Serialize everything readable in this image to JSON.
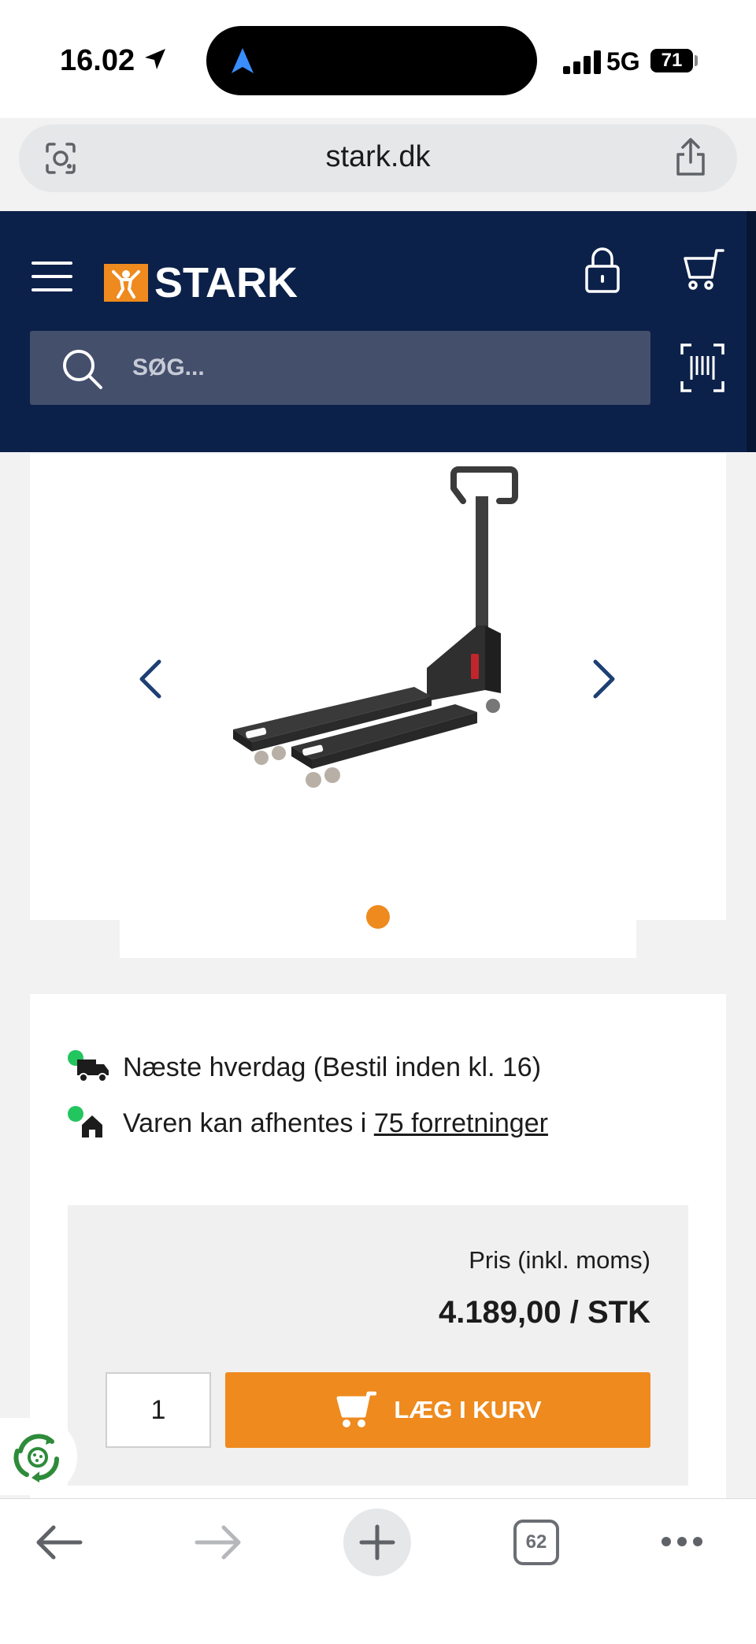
{
  "status_bar": {
    "time": "16.02",
    "network": "5G",
    "battery": "71"
  },
  "browser": {
    "url": "stark.dk",
    "tab_count": "62"
  },
  "header": {
    "logo_text": "STARK",
    "search_placeholder": "SØG..."
  },
  "gallery": {
    "image_count": 1,
    "active_index": 0
  },
  "availability": {
    "delivery_text": "Næste hverdag (Bestil inden kl. 16)",
    "pickup_prefix": "Varen kan afhentes i ",
    "pickup_link": "75 forretninger"
  },
  "price": {
    "label": "Pris (inkl. moms)",
    "value": "4.189,00 / STK"
  },
  "cart": {
    "quantity": "1",
    "button_label": "LÆG I KURV"
  },
  "colors": {
    "header_navy": "#0c2149",
    "accent_orange": "#ee8a1e",
    "status_green": "#22c55e"
  }
}
